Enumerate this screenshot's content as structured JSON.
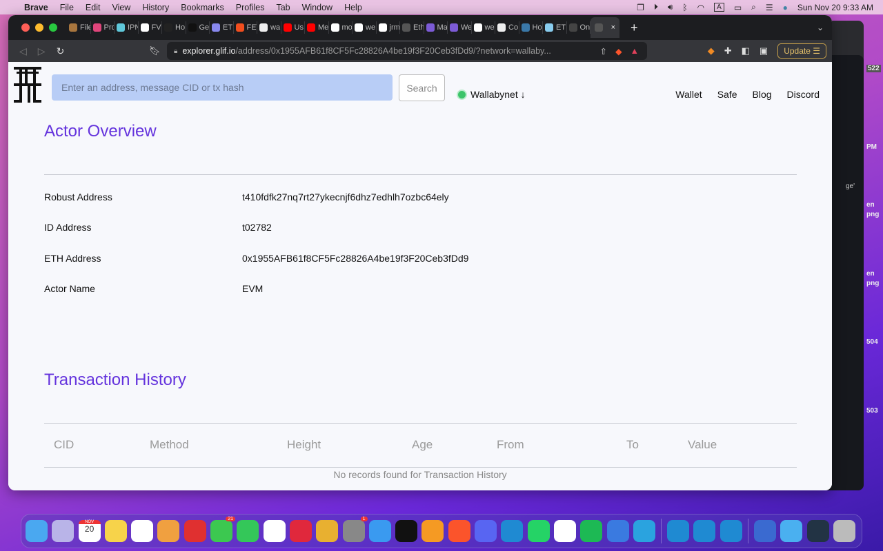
{
  "menubar": {
    "app": "Brave",
    "items": [
      "File",
      "Edit",
      "View",
      "History",
      "Bookmarks",
      "Profiles",
      "Tab",
      "Window",
      "Help"
    ],
    "clock": "Sun Nov 20  9:33 AM"
  },
  "tabs": [
    {
      "label": "File",
      "color": "#a8763e"
    },
    {
      "label": "Pro",
      "color": "#e0457b"
    },
    {
      "label": "IPN",
      "color": "#5fc7d9"
    },
    {
      "label": "FVI",
      "color": "#ffffff"
    },
    {
      "label": "Ho",
      "color": "#222222"
    },
    {
      "label": "Ge",
      "color": "#111111"
    },
    {
      "label": "ETI",
      "color": "#8888ee"
    },
    {
      "label": "FE\\",
      "color": "#f24e1e"
    },
    {
      "label": "wa",
      "color": "#eeeeee"
    },
    {
      "label": "Us",
      "color": "#ff0000"
    },
    {
      "label": "Me",
      "color": "#ff0000"
    },
    {
      "label": "mo",
      "color": "#ffffff"
    },
    {
      "label": "we",
      "color": "#ffffff"
    },
    {
      "label": "jrm",
      "color": "#ffffff"
    },
    {
      "label": "Eth",
      "color": "#555555"
    },
    {
      "label": "Ma",
      "color": "#7c5bd6"
    },
    {
      "label": "We",
      "color": "#7c5bd6"
    },
    {
      "label": "we",
      "color": "#ffffff"
    },
    {
      "label": "Co",
      "color": "#eeeeee"
    },
    {
      "label": "Ho",
      "color": "#3a78a8"
    },
    {
      "label": "ETI",
      "color": "#88ccee"
    },
    {
      "label": "On",
      "color": "#444444"
    }
  ],
  "active_tab": {
    "close": "×"
  },
  "browser": {
    "url_host": "explorer.glif.io",
    "url_path": "/address/0x1955AFB61f8CF5Fc28826A4be19f3F20Ceb3fDd9/?network=wallaby...",
    "update_label": "Update"
  },
  "header": {
    "search_placeholder": "Enter an address, message CID or tx hash",
    "search_button": "Search",
    "network": "Wallabynet ↓",
    "nav": [
      "Wallet",
      "Safe",
      "Blog",
      "Discord"
    ]
  },
  "overview": {
    "title": "Actor Overview",
    "rows": [
      {
        "label": "Robust Address",
        "value": "t410fdfk27nq7rt27ykecnjf6dhz7edhlh7ozbc64ely"
      },
      {
        "label": "ID Address",
        "value": "t02782"
      },
      {
        "label": "ETH Address",
        "value": "0x1955AFB61f8CF5Fc28826A4be19f3F20Ceb3fDd9"
      },
      {
        "label": "Actor Name",
        "value": "EVM"
      }
    ]
  },
  "transactions": {
    "title": "Transaction History",
    "columns": [
      "CID",
      "Method",
      "Height",
      "Age",
      "From",
      "To",
      "Value"
    ],
    "empty": "No records found for Transaction History"
  },
  "background_window": {
    "texts": [
      "522",
      "PM",
      "ge'",
      "en",
      "png",
      "en",
      "png",
      "504",
      "503"
    ]
  },
  "dock": {
    "apps": [
      {
        "name": "finder",
        "color": "#4aa8f0"
      },
      {
        "name": "launchpad",
        "color": "#b9b4e8"
      },
      {
        "name": "calendar",
        "color": "#ffffff",
        "text": "20",
        "month": "NOV"
      },
      {
        "name": "notes",
        "color": "#f7d34a"
      },
      {
        "name": "reminders",
        "color": "#ffffff"
      },
      {
        "name": "photos",
        "color": "#f0a040"
      },
      {
        "name": "app",
        "color": "#e03030"
      },
      {
        "name": "messages",
        "color": "#3cc850",
        "badge": "21"
      },
      {
        "name": "facetime",
        "color": "#34c759"
      },
      {
        "name": "news",
        "color": "#ffffff"
      },
      {
        "name": "app",
        "color": "#e0283c"
      },
      {
        "name": "chrome",
        "color": "#e8b030"
      },
      {
        "name": "system-preferences",
        "color": "#888888",
        "badge": "1"
      },
      {
        "name": "safari",
        "color": "#3a9af0"
      },
      {
        "name": "terminal",
        "color": "#111111"
      },
      {
        "name": "sublime-text",
        "color": "#f59a23"
      },
      {
        "name": "brave",
        "color": "#fb542b"
      },
      {
        "name": "discord",
        "color": "#5865f2"
      },
      {
        "name": "vscode",
        "color": "#1f8ad2"
      },
      {
        "name": "whatsapp",
        "color": "#25d366"
      },
      {
        "name": "notion",
        "color": "#ffffff"
      },
      {
        "name": "spotify",
        "color": "#1db954"
      },
      {
        "name": "xcode",
        "color": "#3a7ae0"
      },
      {
        "name": "telegram",
        "color": "#2aa3df"
      }
    ],
    "apps2": [
      {
        "name": "vscode",
        "color": "#1f8ad2"
      },
      {
        "name": "vscode",
        "color": "#1f8ad2"
      },
      {
        "name": "vscode",
        "color": "#1f8ad2"
      }
    ],
    "apps3": [
      {
        "name": "app",
        "color": "#3a6ad0"
      },
      {
        "name": "downloads",
        "color": "#4ab0f0"
      },
      {
        "name": "screen",
        "color": "#223344"
      },
      {
        "name": "trash",
        "color": "#bbbbbb"
      }
    ]
  }
}
